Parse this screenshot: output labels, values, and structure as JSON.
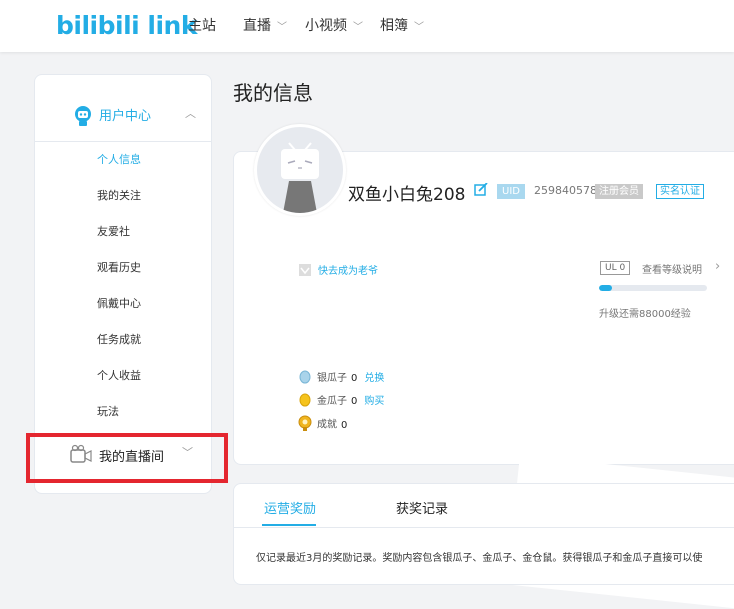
{
  "header": {
    "logo": "bilibili link",
    "nav": [
      {
        "label": "主站"
      },
      {
        "label": "直播"
      },
      {
        "label": "小视频"
      },
      {
        "label": "相簿"
      }
    ]
  },
  "sidebar": {
    "section_title": "用户中心",
    "items": [
      {
        "label": "个人信息"
      },
      {
        "label": "我的关注"
      },
      {
        "label": "友爱社"
      },
      {
        "label": "观看历史"
      },
      {
        "label": "佩戴中心"
      },
      {
        "label": "任务成就"
      },
      {
        "label": "个人收益"
      },
      {
        "label": "玩法"
      }
    ],
    "live_section_title": "我的直播间"
  },
  "page": {
    "title": "我的信息"
  },
  "profile": {
    "username": "双鱼小白兔208",
    "uid_label": "UID",
    "uid": "259840578",
    "member_badge": "注册会员",
    "verify_badge": "实名认证",
    "vip_link": "快去成为老爷",
    "level_badge": "UL 0",
    "level_link": "查看等级说明",
    "level_progress": 0.12,
    "upgrade_text": "升级还需88000经验",
    "coins": [
      {
        "label": "银瓜子",
        "value": "0",
        "action": "兑换",
        "icon": "silver-seed-icon"
      },
      {
        "label": "金瓜子",
        "value": "0",
        "action": "购买",
        "icon": "gold-seed-icon"
      },
      {
        "label": "成就",
        "value": "0",
        "action": "",
        "icon": "medal-icon"
      }
    ]
  },
  "rewards": {
    "tabs": [
      {
        "label": "运营奖励"
      },
      {
        "label": "获奖记录"
      }
    ],
    "notice": "仅记录最近3月的奖励记录。奖励内容包含银瓜子、金瓜子、金仓鼠。获得银瓜子和金瓜子直接可以使"
  },
  "colors": {
    "accent": "#23ade5",
    "highlight_box": "#e4262f"
  }
}
